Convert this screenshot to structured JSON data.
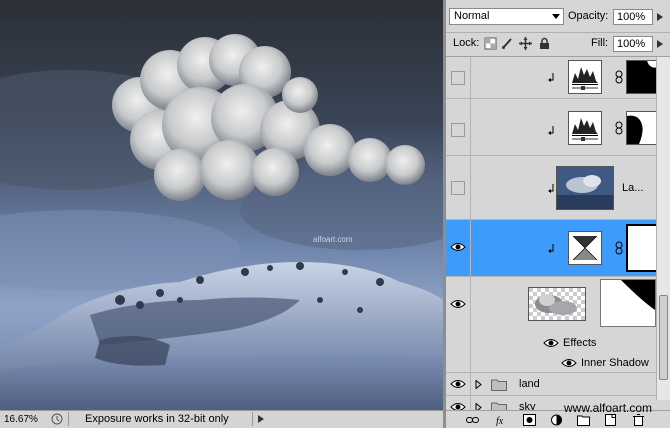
{
  "canvas": {
    "watermark": "alfoart.com"
  },
  "statusbar": {
    "zoom": "16.67%",
    "message": "Exposure works in 32-bit only"
  },
  "layers_panel": {
    "blend_mode": "Normal",
    "opacity_label": "Opacity:",
    "opacity_value": "100%",
    "lock_label": "Lock:",
    "fill_label": "Fill:",
    "fill_value": "100%",
    "layers": [
      {
        "name": "",
        "visible": false,
        "clipped": true,
        "type": "adjustment"
      },
      {
        "name": "",
        "visible": false,
        "clipped": true,
        "type": "adjustment"
      },
      {
        "name": "La...",
        "visible": false,
        "clipped": true,
        "type": "image"
      },
      {
        "name": "",
        "visible": true,
        "clipped": true,
        "selected": true,
        "type": "adjustment"
      },
      {
        "name": "",
        "visible": true,
        "clipped": false,
        "type": "masked"
      }
    ],
    "effects_label": "Effects",
    "inner_shadow_label": "Inner Shadow",
    "groups": [
      {
        "name": "land",
        "visible": true
      },
      {
        "name": "sky",
        "visible": true
      }
    ]
  },
  "footer_watermark": "www.alfoart.com",
  "colors": {
    "selection": "#3d9cfb",
    "panel": "#d6d6d6"
  }
}
